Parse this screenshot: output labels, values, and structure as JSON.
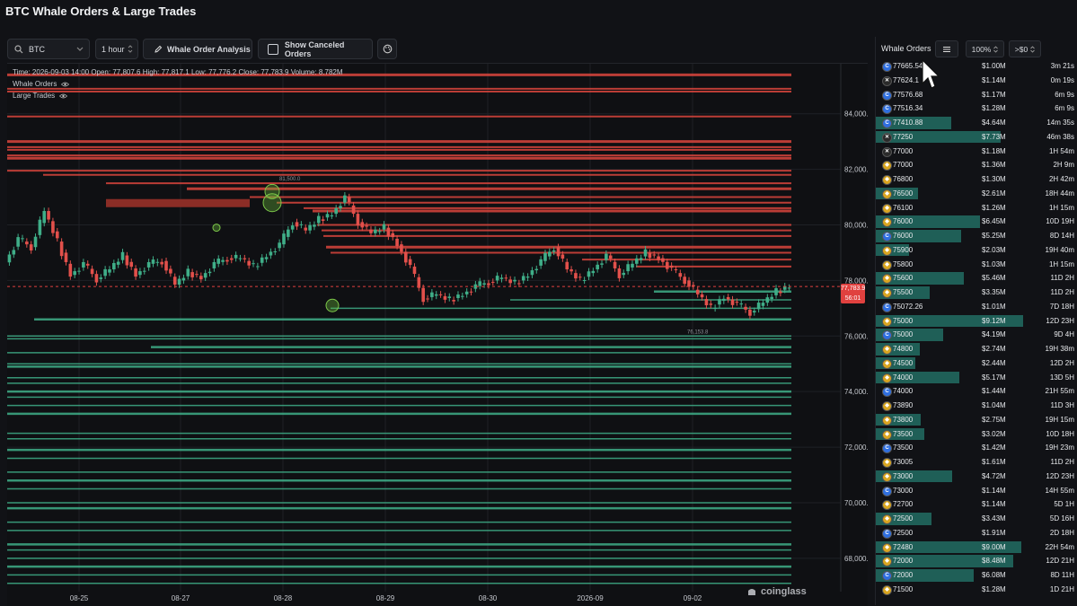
{
  "page": {
    "title": "BTC Whale Orders & Large Trades"
  },
  "toolbar": {
    "symbol": "BTC",
    "interval": "1 hour",
    "analysis_label": "Whale Order Analysis",
    "canceled_label": "Show Canceled Orders"
  },
  "legend": {
    "ohlc": "Time: 2026-09-03 14:00    Open: 77,807.6    High: 77,817.1    Low: 77,776.2    Close: 77,783.9    Volume: 8.782M",
    "whale_orders": "Whale Orders",
    "large_trades": "Large Trades"
  },
  "colors": {
    "bid": "#3fae88",
    "ask": "#d9453d",
    "up": "#3fae88",
    "down": "#e2504b",
    "bar": "#1f5f57",
    "accent": "#e0413f"
  },
  "chart_data": {
    "type": "line",
    "title": "",
    "x_ticks": [
      "08-25",
      "08-27",
      "08-28",
      "08-29",
      "08-30",
      "2026-09",
      "09-02"
    ],
    "y_ticks": [
      "84,000.0",
      "82,000.0",
      "80,000.0",
      "78,000.0",
      "76,000.0",
      "74,000.0",
      "72,000.0",
      "70,000.0",
      "68,000.0"
    ],
    "ylim": [
      66800,
      85800
    ],
    "current_price": {
      "value": 77783.9,
      "label": "77,783.9",
      "countdown": "56:01"
    },
    "annotations": [
      {
        "text": "81,500.0",
        "value": 81500
      },
      {
        "text": "76,153.8",
        "value": 76153.8
      }
    ],
    "price_path": [
      [
        0,
        78650
      ],
      [
        1,
        79500
      ],
      [
        2,
        79200
      ],
      [
        3,
        80500
      ],
      [
        4,
        79400
      ],
      [
        5,
        78200
      ],
      [
        6,
        78600
      ],
      [
        7,
        78050
      ],
      [
        8,
        78400
      ],
      [
        9,
        78900
      ],
      [
        10,
        78200
      ],
      [
        11,
        78600
      ],
      [
        12,
        78700
      ],
      [
        13,
        77850
      ],
      [
        14,
        78300
      ],
      [
        15,
        78100
      ],
      [
        16,
        78600
      ],
      [
        17,
        78800
      ],
      [
        18,
        78800
      ],
      [
        19,
        78500
      ],
      [
        20,
        78900
      ],
      [
        21,
        79300
      ],
      [
        22,
        80100
      ],
      [
        23,
        79800
      ],
      [
        24,
        80200
      ],
      [
        25,
        80400
      ],
      [
        26,
        81000
      ],
      [
        27,
        80100
      ],
      [
        28,
        79700
      ],
      [
        29,
        79900
      ],
      [
        30,
        79300
      ],
      [
        31,
        78500
      ],
      [
        32,
        77350
      ],
      [
        33,
        77500
      ],
      [
        34,
        77300
      ],
      [
        35,
        77500
      ],
      [
        36,
        77800
      ],
      [
        37,
        77950
      ],
      [
        38,
        78100
      ],
      [
        39,
        77900
      ],
      [
        40,
        78200
      ],
      [
        41,
        78700
      ],
      [
        42,
        79200
      ],
      [
        43,
        78400
      ],
      [
        44,
        78000
      ],
      [
        45,
        78400
      ],
      [
        46,
        78900
      ],
      [
        47,
        78200
      ],
      [
        48,
        78600
      ],
      [
        49,
        79000
      ],
      [
        50,
        78800
      ],
      [
        51,
        78400
      ],
      [
        52,
        78000
      ],
      [
        53,
        77500
      ],
      [
        54,
        77000
      ],
      [
        55,
        77400
      ],
      [
        56,
        77150
      ],
      [
        57,
        76850
      ],
      [
        58,
        77200
      ],
      [
        59,
        77600
      ],
      [
        60,
        77800
      ]
    ],
    "whale_ask_levels": [
      85400,
      84900,
      84800,
      83900,
      83000,
      82800,
      82700,
      82500,
      82400,
      81950,
      81800,
      81500,
      81300,
      81000,
      80800,
      80600,
      80500,
      80000,
      79800,
      79600,
      79200,
      79000,
      78750,
      78500
    ],
    "whale_bid_levels": [
      77600,
      77300,
      77000,
      76600,
      76000,
      75900,
      75600,
      75400,
      75000,
      74900,
      74500,
      74300,
      74000,
      73800,
      73500,
      73200,
      72500,
      72300,
      71900,
      71600,
      71100,
      70800,
      70500,
      70000,
      69800,
      69300,
      69000,
      68500,
      68300,
      68000,
      67700,
      67400,
      67100
    ],
    "ask_block": {
      "value": 80800,
      "label": "81,500.0"
    }
  },
  "side_panel": {
    "title": "Whale Orders",
    "zoom": "100%",
    "filter": ">$0",
    "rows": [
      {
        "ex": "C",
        "price": "77665.54",
        "amount": "$1.00M",
        "age": "3m 21s",
        "side": "ask",
        "size": 1.0
      },
      {
        "ex": "X",
        "price": "77624.1",
        "amount": "$1.14M",
        "age": "0m 19s",
        "side": "ask",
        "size": 1.14
      },
      {
        "ex": "C",
        "price": "77576.68",
        "amount": "$1.17M",
        "age": "6m 9s",
        "side": "ask",
        "size": 1.17
      },
      {
        "ex": "C",
        "price": "77516.34",
        "amount": "$1.28M",
        "age": "6m 9s",
        "side": "ask",
        "size": 1.28
      },
      {
        "ex": "C",
        "price": "77410.88",
        "amount": "$4.64M",
        "age": "14m 35s",
        "side": "bid",
        "size": 4.64
      },
      {
        "ex": "X",
        "price": "77250",
        "amount": "$7.73M",
        "age": "46m 38s",
        "side": "bid",
        "size": 7.73
      },
      {
        "ex": "X",
        "price": "77000",
        "amount": "$1.18M",
        "age": "1H 54m",
        "side": "bid",
        "size": 1.18
      },
      {
        "ex": "B",
        "price": "77000",
        "amount": "$1.36M",
        "age": "2H 9m",
        "side": "bid",
        "size": 1.36
      },
      {
        "ex": "B",
        "price": "76800",
        "amount": "$1.30M",
        "age": "2H 42m",
        "side": "bid",
        "size": 1.3
      },
      {
        "ex": "B",
        "price": "76500",
        "amount": "$2.61M",
        "age": "18H 44m",
        "side": "bid",
        "size": 2.61
      },
      {
        "ex": "B",
        "price": "76100",
        "amount": "$1.26M",
        "age": "1H 15m",
        "side": "bid",
        "size": 1.26
      },
      {
        "ex": "B",
        "price": "76000",
        "amount": "$6.45M",
        "age": "10D 19H",
        "side": "bid",
        "size": 6.45
      },
      {
        "ex": "C",
        "price": "76000",
        "amount": "$5.25M",
        "age": "8D 14H",
        "side": "bid",
        "size": 5.25
      },
      {
        "ex": "B",
        "price": "75900",
        "amount": "$2.03M",
        "age": "19H 40m",
        "side": "bid",
        "size": 2.03
      },
      {
        "ex": "B",
        "price": "75800",
        "amount": "$1.03M",
        "age": "1H 15m",
        "side": "bid",
        "size": 1.03
      },
      {
        "ex": "B",
        "price": "75600",
        "amount": "$5.46M",
        "age": "11D 2H",
        "side": "bid",
        "size": 5.46
      },
      {
        "ex": "B",
        "price": "75500",
        "amount": "$3.35M",
        "age": "11D 2H",
        "side": "bid",
        "size": 3.35
      },
      {
        "ex": "C",
        "price": "75072.26",
        "amount": "$1.01M",
        "age": "7D 18H",
        "side": "bid",
        "size": 1.01
      },
      {
        "ex": "B",
        "price": "75000",
        "amount": "$9.12M",
        "age": "12D 23H",
        "side": "bid",
        "size": 9.12
      },
      {
        "ex": "C",
        "price": "75000",
        "amount": "$4.19M",
        "age": "9D 4H",
        "side": "bid",
        "size": 4.19
      },
      {
        "ex": "B",
        "price": "74800",
        "amount": "$2.74M",
        "age": "19H 38m",
        "side": "bid",
        "size": 2.74
      },
      {
        "ex": "B",
        "price": "74500",
        "amount": "$2.44M",
        "age": "12D 2H",
        "side": "bid",
        "size": 2.44
      },
      {
        "ex": "B",
        "price": "74000",
        "amount": "$5.17M",
        "age": "13D 5H",
        "side": "bid",
        "size": 5.17
      },
      {
        "ex": "C",
        "price": "74000",
        "amount": "$1.44M",
        "age": "21H 55m",
        "side": "bid",
        "size": 1.44
      },
      {
        "ex": "B",
        "price": "73890",
        "amount": "$1.04M",
        "age": "11D 3H",
        "side": "bid",
        "size": 1.04
      },
      {
        "ex": "B",
        "price": "73800",
        "amount": "$2.75M",
        "age": "19H 15m",
        "side": "bid",
        "size": 2.75
      },
      {
        "ex": "B",
        "price": "73500",
        "amount": "$3.02M",
        "age": "10D 18H",
        "side": "bid",
        "size": 3.02
      },
      {
        "ex": "C",
        "price": "73500",
        "amount": "$1.42M",
        "age": "19H 23m",
        "side": "bid",
        "size": 1.42
      },
      {
        "ex": "B",
        "price": "73005",
        "amount": "$1.61M",
        "age": "11D 2H",
        "side": "bid",
        "size": 1.61
      },
      {
        "ex": "B",
        "price": "73000",
        "amount": "$4.72M",
        "age": "12D 23H",
        "side": "bid",
        "size": 4.72
      },
      {
        "ex": "C",
        "price": "73000",
        "amount": "$1.14M",
        "age": "14H 55m",
        "side": "bid",
        "size": 1.14
      },
      {
        "ex": "B",
        "price": "72700",
        "amount": "$1.14M",
        "age": "5D 1H",
        "side": "bid",
        "size": 1.14
      },
      {
        "ex": "B",
        "price": "72500",
        "amount": "$3.43M",
        "age": "5D 16H",
        "side": "bid",
        "size": 3.43
      },
      {
        "ex": "C",
        "price": "72500",
        "amount": "$1.91M",
        "age": "2D 18H",
        "side": "bid",
        "size": 1.91
      },
      {
        "ex": "B",
        "price": "72480",
        "amount": "$9.00M",
        "age": "22H 54m",
        "side": "bid",
        "size": 9.0
      },
      {
        "ex": "B",
        "price": "72000",
        "amount": "$8.48M",
        "age": "12D 21H",
        "side": "bid",
        "size": 8.48
      },
      {
        "ex": "C",
        "price": "72000",
        "amount": "$6.08M",
        "age": "8D 11H",
        "side": "bid",
        "size": 6.08
      },
      {
        "ex": "B",
        "price": "71500",
        "amount": "$1.28M",
        "age": "1D 21H",
        "side": "bid",
        "size": 1.28
      }
    ]
  },
  "brand": "coinglass"
}
